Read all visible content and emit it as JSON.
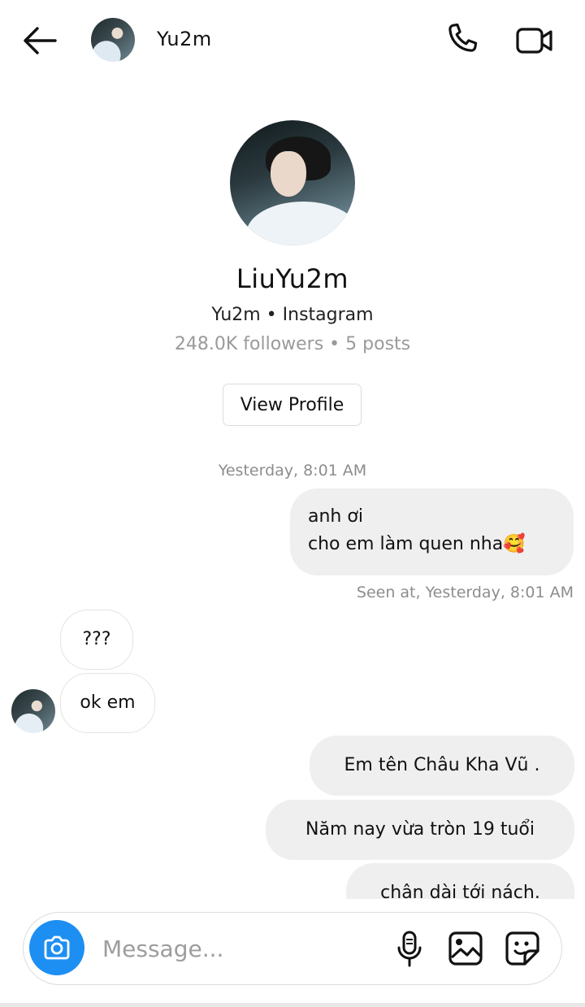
{
  "header": {
    "name": "Yu2m",
    "icons": {
      "back": "back-arrow-icon",
      "call": "phone-icon",
      "video": "video-camera-icon"
    }
  },
  "profile": {
    "display_name": "LiuYu2m",
    "subtitle": "Yu2m • Instagram",
    "stats": "248.0K followers • 5 posts",
    "view_profile_label": "View Profile"
  },
  "conversation": {
    "timestamp": "Yesterday, 8:01 AM",
    "messages": [
      {
        "from": "me",
        "lines": [
          "anh ơi",
          "cho em làm quen nha🥰"
        ]
      },
      {
        "from": "them",
        "text": "???"
      },
      {
        "from": "them",
        "text": "ok em"
      },
      {
        "from": "me",
        "text": "Em tên Châu Kha Vũ ."
      },
      {
        "from": "me",
        "text": "Năm nay vừa tròn 19 tuổi"
      },
      {
        "from": "me",
        "text": "chân dài tới nách."
      }
    ],
    "seen": "Seen at, Yesterday, 8:01 AM"
  },
  "composer": {
    "placeholder": "Message...",
    "camera_color": "#1d8ff2",
    "icons": {
      "camera": "camera-icon",
      "mic": "microphone-icon",
      "gallery": "gallery-icon",
      "sticker": "sticker-icon"
    }
  }
}
